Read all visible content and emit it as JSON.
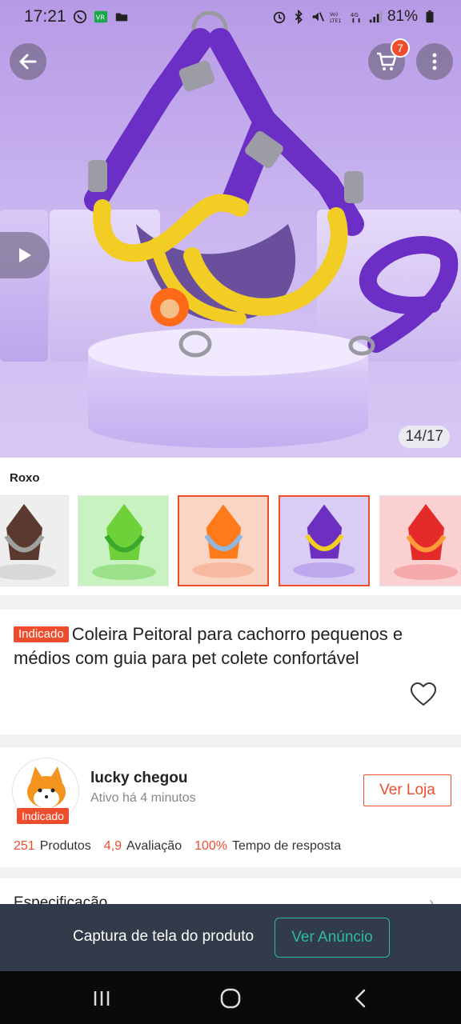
{
  "status_bar": {
    "time": "17:21",
    "battery": "81%"
  },
  "header": {
    "cart_count": "7"
  },
  "gallery": {
    "counter": "14/17"
  },
  "variation": {
    "label": "Roxo",
    "options": [
      {
        "name": "brown",
        "color": "#5a3a2e",
        "selected": false
      },
      {
        "name": "green",
        "color": "#6ed13a",
        "selected": false
      },
      {
        "name": "orange",
        "color": "#ff7a1a",
        "selected": true
      },
      {
        "name": "purple",
        "color": "#6c2fc0",
        "selected": true
      },
      {
        "name": "red",
        "color": "#e52a2a",
        "selected": false
      }
    ]
  },
  "product": {
    "tag": "Indicado",
    "title": "Coleira Peitoral para cachorro pequenos e médios com guia para pet colete confortável"
  },
  "shop": {
    "name": "lucky chegou",
    "active": "Ativo há 4 minutos",
    "tag": "Indicado",
    "visit_label": "Ver Loja",
    "stats": [
      {
        "value": "251",
        "label": "Produtos"
      },
      {
        "value": "4,9",
        "label": "Avaliação"
      },
      {
        "value": "100%",
        "label": "Tempo de resposta"
      }
    ]
  },
  "spec": {
    "label": "Especificação"
  },
  "capture_bar": {
    "text": "Captura de tela do produto",
    "button": "Ver Anúncio"
  },
  "colors": {
    "accent": "#ee4d2d",
    "teal": "#2fb8a8",
    "overlay": "#323b49"
  }
}
